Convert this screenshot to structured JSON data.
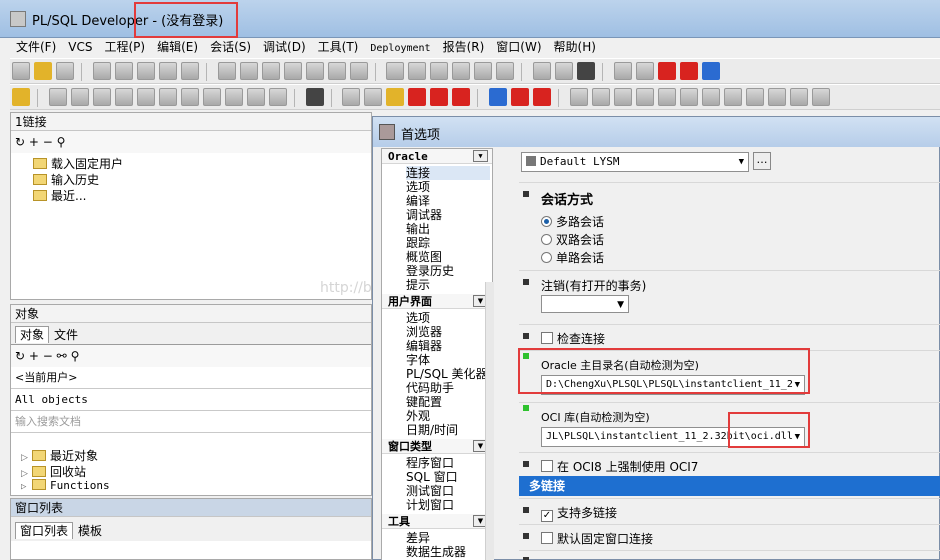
{
  "window": {
    "title": "PL/SQL Developer - (没有登录)"
  },
  "menu": [
    "文件(F)",
    "VCS",
    "工程(P)",
    "编辑(E)",
    "会话(S)",
    "调试(D)",
    "工具(T)",
    "Deployment",
    "报告(R)",
    "窗口(W)",
    "帮助(H)"
  ],
  "connections_panel": {
    "title": "1链接",
    "items": [
      "载入固定用户",
      "输入历史",
      "最近..."
    ]
  },
  "objects_panel": {
    "title": "对象",
    "tabs": [
      "对象",
      "文件"
    ],
    "user_combo": "<当前用户>",
    "filter_combo": "All objects",
    "search_placeholder": "输入搜索文档",
    "items": [
      "最近对象",
      "回收站",
      "Functions"
    ]
  },
  "windowlist_panel": {
    "title": "窗口列表",
    "tabs": [
      "窗口列表",
      "模板"
    ]
  },
  "dialog": {
    "title": "首选项",
    "profile": "Default LYSM",
    "categories": [
      {
        "name": "Oracle",
        "items": [
          "连接",
          "选项",
          "编译",
          "调试器",
          "输出",
          "跟踪",
          "概览图",
          "登录历史",
          "提示"
        ]
      },
      {
        "name": "用户界面",
        "items": [
          "选项",
          "浏览器",
          "编辑器",
          "字体",
          "PL/SQL 美化器",
          "代码助手",
          "键配置",
          "外观",
          "日期/时间"
        ]
      },
      {
        "name": "窗口类型",
        "items": [
          "程序窗口",
          "SQL 窗口",
          "测试窗口",
          "计划窗口"
        ]
      },
      {
        "name": "工具",
        "items": [
          "差异",
          "数据生成器"
        ]
      }
    ],
    "session_mode": {
      "label": "会话方式",
      "options": [
        "多路会话",
        "双路会话",
        "单路会话"
      ],
      "selected": "多路会话"
    },
    "logoff_label": "注销(有打开的事务)",
    "logoff_value": "",
    "check_connection": "检查连接",
    "oracle_home": {
      "label": "Oracle 主目录名(自动检测为空)",
      "value": "D:\\ChengXu\\PLSQL\\PLSQL\\instantclient_11_2"
    },
    "oci_library": {
      "label": "OCI 库(自动检测为空)",
      "value": "JL\\PLSQL\\instantclient_11_2.32bit\\oci.dll"
    },
    "force_oci7": "在 OCI8 上强制使用 OCI7",
    "multi_conn": {
      "header": "多链接",
      "support": "支持多链接",
      "default_fixed": "默认固定窗口连接"
    }
  },
  "watermark": "http://blog.csdn.net/..."
}
